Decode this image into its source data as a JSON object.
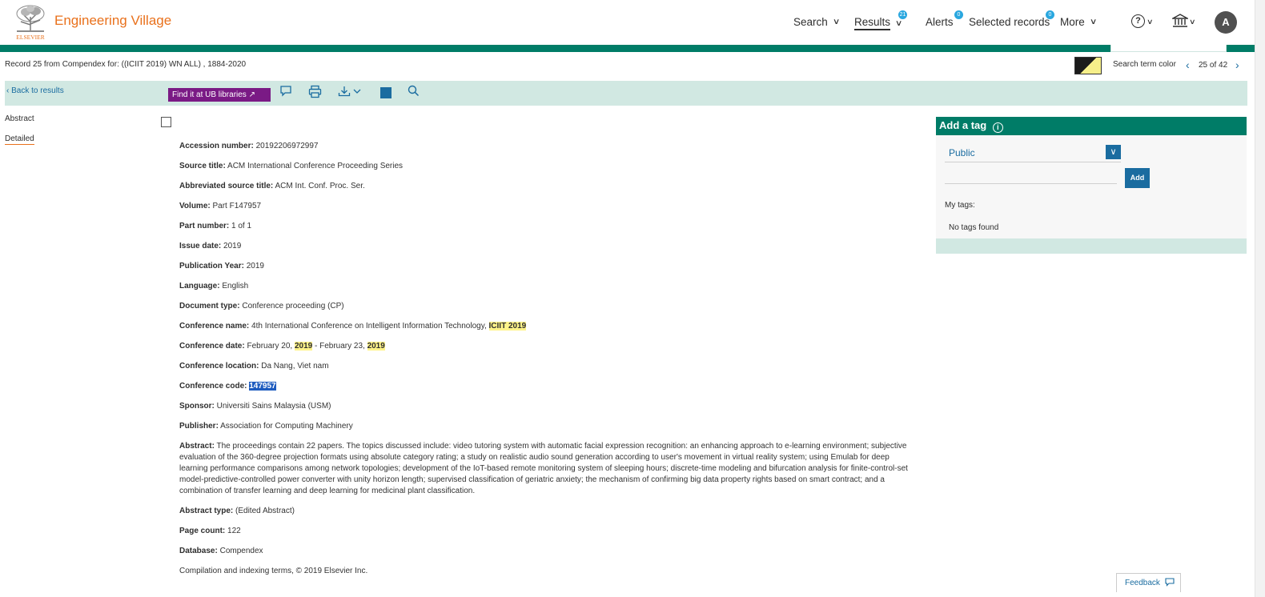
{
  "header": {
    "logo_text": "Engineering Village",
    "logo_caption": "ELSEVIER",
    "nav": {
      "search": "Search",
      "results": "Results",
      "results_badge": "21",
      "alerts": "Alerts",
      "alerts_badge": "0",
      "selected": "Selected records",
      "selected_badge": "0",
      "more": "More"
    },
    "help_glyph": "?",
    "avatar_initial": "A"
  },
  "record_line": "Record 25 from Compendex for: ((ICIIT 2019) WN ALL) , 1884-2020",
  "search_term_color_label": "Search term color",
  "pager": {
    "text": "25 of 42"
  },
  "toolbar": {
    "back": "Back to results",
    "find": "Find it at UB libraries"
  },
  "left_nav": {
    "abstract": "Abstract",
    "detailed": "Detailed"
  },
  "fields": {
    "accession": {
      "k": "Accession number:",
      "v": " 20192206972997"
    },
    "source_title": {
      "k": "Source title:",
      "v": " ACM International Conference Proceeding Series"
    },
    "abbrev_title": {
      "k": "Abbreviated source title:",
      "v": " ACM Int. Conf. Proc. Ser."
    },
    "volume": {
      "k": "Volume:",
      "v": " Part F147957"
    },
    "part_number": {
      "k": "Part number:",
      "v": " 1 of 1"
    },
    "issue_date": {
      "k": "Issue date:",
      "v": " 2019"
    },
    "pub_year": {
      "k": "Publication Year:",
      "v": " 2019"
    },
    "language": {
      "k": "Language:",
      "v": " English"
    },
    "doc_type": {
      "k": "Document type:",
      "v": " Conference proceeding (CP)"
    },
    "conf_name": {
      "k": "Conference name:",
      "v": " 4th International Conference on Intelligent Information Technology, ",
      "hl": "ICIIT 2019"
    },
    "conf_date": {
      "k": "Conference date:",
      "v1": " February 20, ",
      "hl1": "2019",
      "v2": " - February 23, ",
      "hl2": "2019"
    },
    "conf_location": {
      "k": "Conference location:",
      "v": " Da Nang, Viet nam"
    },
    "conf_code": {
      "k": "Conference code:",
      "v": " ",
      "sel": "147957"
    },
    "sponsor": {
      "k": "Sponsor:",
      "v": " Universiti Sains Malaysia (USM)"
    },
    "publisher": {
      "k": "Publisher:",
      "v": " Association for Computing Machinery"
    },
    "abstract": {
      "k": "Abstract:",
      "v": " The proceedings contain 22 papers. The topics discussed include: video tutoring system with automatic facial expression recognition: an enhancing approach to e-learning environment; subjective evaluation of the 360-degree projection formats using absolute category rating; a study on realistic audio sound generation according to user's movement in virtual reality system; using Emulab for deep learning performance comparisons among network topologies; development of the IoT-based remote monitoring system of sleeping hours; discrete-time modeling and bifurcation analysis for finite-control-set model-predictive-controlled power converter with unity horizon length; supervised classification of geriatric anxiety; the mechanism of confirming big data property rights based on smart contract; and a combination of transfer learning and deep learning for medicinal plant classification."
    },
    "abstract_type": {
      "k": "Abstract type:",
      "v": " (Edited Abstract)"
    },
    "page_count": {
      "k": "Page count:",
      "v": " 122"
    },
    "database": {
      "k": "Database:",
      "v": " Compendex"
    },
    "copyright": "Compilation and indexing terms, © 2019 Elsevier Inc."
  },
  "tags": {
    "header": "Add a tag",
    "info_glyph": "i",
    "visibility": "Public",
    "add": "Add",
    "my_tags": "My tags:",
    "no_tags": "No tags found"
  },
  "feedback": "Feedback",
  "colors": {
    "brand_orange": "#e9711c",
    "brand_green": "#007c67",
    "toolbar_bg": "#d1e8e2",
    "link_blue": "#1a6ca0",
    "find_purple": "#7a1a85",
    "highlight": "#fff48a"
  }
}
